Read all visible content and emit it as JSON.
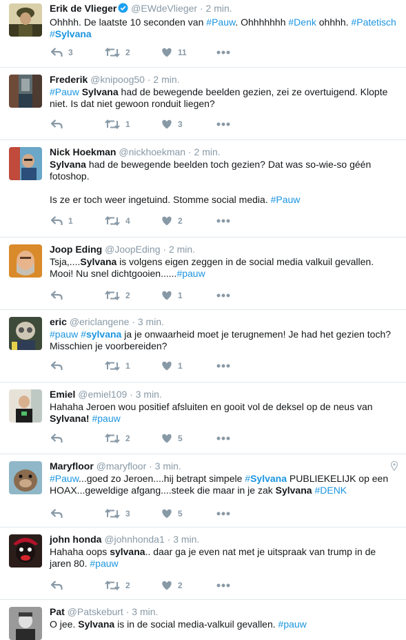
{
  "colors": {
    "link": "#1b95e0",
    "muted": "#8899a6",
    "text": "#14171a",
    "border": "#e1e8ed",
    "verified": "#1da1f2"
  },
  "icons": {
    "reply": "reply-arrow-icon",
    "retweet": "retweet-icon",
    "like": "heart-icon",
    "more": "more-dots-icon",
    "verified": "verified-badge-icon",
    "location": "location-pin-icon"
  },
  "tweets": [
    {
      "name": "Erik de Vlieger",
      "handle": "@EWdeVlieger",
      "sep": "·",
      "time": "2 min.",
      "text": [
        [
          {
            "t": "Ohhhh. De laatste 10 seconden van "
          },
          {
            "t": "#Pauw",
            "tag": true
          },
          {
            "t": ". Ohhhhhhh "
          },
          {
            "t": "#Denk",
            "tag": true
          },
          {
            "t": " ohhhh. "
          },
          {
            "t": "#Patetisch",
            "tag": true
          },
          {
            "t": " "
          },
          {
            "t": "#",
            "tag": true
          },
          {
            "t": "Sylvana",
            "tag": true,
            "b": true
          }
        ]
      ],
      "replies": "3",
      "retweets": "2",
      "likes": "11"
    },
    {
      "name": "Frederik",
      "handle": "@knipoog50",
      "sep": "·",
      "time": "2 min.",
      "text": [
        [
          {
            "t": "#Pauw",
            "tag": true
          },
          {
            "t": " "
          },
          {
            "t": "Sylvana",
            "b": true
          },
          {
            "t": " had de bewegende beelden gezien, zei ze overtuigend. Klopte niet. Is dat niet gewoon ronduit liegen?"
          }
        ]
      ],
      "replies": "",
      "retweets": "1",
      "likes": "3"
    },
    {
      "name": "Nick Hoekman",
      "handle": "@nickhoekman",
      "sep": "·",
      "time": "2 min.",
      "text": [
        [
          {
            "t": "Sylvana",
            "b": true
          },
          {
            "t": " had de bewegende beelden toch gezien? Dat was so-wie-so géén fotoshop."
          }
        ],
        [
          {
            "t": "Is ze er toch weer ingetuind. Stomme social media. "
          },
          {
            "t": "#Pauw",
            "tag": true
          }
        ]
      ],
      "replies": "1",
      "retweets": "4",
      "likes": "2"
    },
    {
      "name": "Joop Eding",
      "handle": "@JoopEding",
      "sep": "·",
      "time": "2 min.",
      "text": [
        [
          {
            "t": "Tsja,...."
          },
          {
            "t": "Sylvana",
            "b": true
          },
          {
            "t": " is volgens eigen zeggen in de social media valkuil gevallen. Mooi! Nu snel dichtgooien......"
          },
          {
            "t": "#pauw",
            "tag": true
          }
        ]
      ],
      "replies": "",
      "retweets": "2",
      "likes": "1"
    },
    {
      "name": "eric",
      "handle": "@ericlangene",
      "sep": "·",
      "time": "3 min.",
      "text": [
        [
          {
            "t": "#pauw",
            "tag": true
          },
          {
            "t": " "
          },
          {
            "t": "#",
            "tag": true
          },
          {
            "t": "sylvana",
            "tag": true,
            "b": true
          },
          {
            "t": " ja je onwaarheid moet je terugnemen! Je had het gezien toch? Misschien je voorbereiden?"
          }
        ]
      ],
      "replies": "",
      "retweets": "1",
      "likes": "1"
    },
    {
      "name": "Emiel",
      "handle": "@emiel109",
      "sep": "·",
      "time": "3 min.",
      "text": [
        [
          {
            "t": "Hahaha Jeroen wou positief afsluiten en gooit vol de deksel op de neus van "
          },
          {
            "t": "Sylvana!",
            "b": true
          },
          {
            "t": " "
          },
          {
            "t": "#pauw",
            "tag": true
          }
        ]
      ],
      "replies": "",
      "retweets": "2",
      "likes": "5"
    },
    {
      "name": "Maryfloor",
      "handle": "@maryfloor",
      "sep": "·",
      "time": "3 min.",
      "text": [
        [
          {
            "t": "#Pauw",
            "tag": true
          },
          {
            "t": "...goed zo Jeroen....hij betrapt simpele "
          },
          {
            "t": "#",
            "tag": true
          },
          {
            "t": "Sylvana",
            "tag": true,
            "b": true
          },
          {
            "t": " PUBLIEKELIJK op een HOAX...geweldige afgang....steek die maar in je zak "
          },
          {
            "t": "Sylvana",
            "b": true
          },
          {
            "t": " "
          },
          {
            "t": "#DENK",
            "tag": true
          }
        ]
      ],
      "replies": "",
      "retweets": "3",
      "likes": "5"
    },
    {
      "name": "john honda",
      "handle": "@johnhonda1",
      "sep": "·",
      "time": "3 min.",
      "text": [
        [
          {
            "t": "Hahaha oops "
          },
          {
            "t": "sylvana",
            "b": true
          },
          {
            "t": ".. daar ga je even nat met je uitspraak van trump in de jaren 80.  "
          },
          {
            "t": "#pauw",
            "tag": true
          }
        ]
      ],
      "replies": "",
      "retweets": "2",
      "likes": "2"
    },
    {
      "name": "Pat",
      "handle": "@Patskeburt",
      "sep": "·",
      "time": "3 min.",
      "text": [
        [
          {
            "t": "O jee. "
          },
          {
            "t": "Sylvana",
            "b": true
          },
          {
            "t": " is in de social media-valkuil gevallen. "
          },
          {
            "t": "#pauw",
            "tag": true
          }
        ]
      ],
      "replies": "",
      "retweets": "",
      "likes": ""
    }
  ]
}
